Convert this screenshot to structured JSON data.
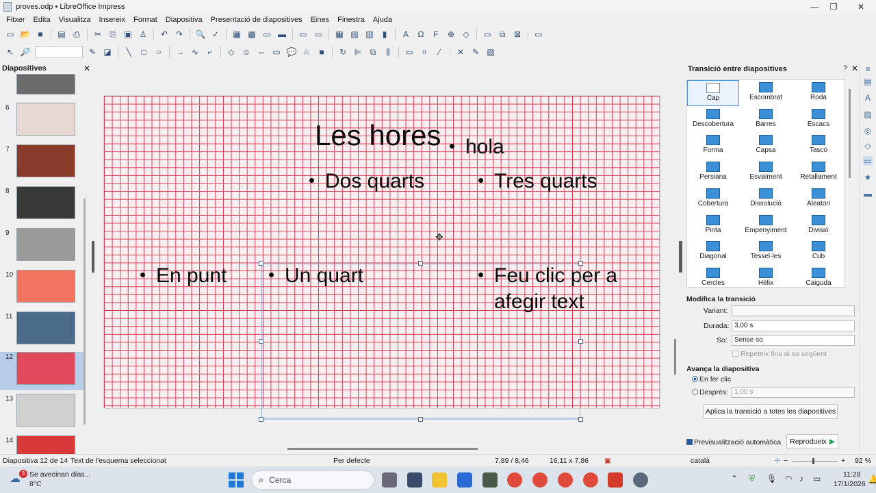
{
  "window": {
    "title": "proves.odp • LibreOffice Impress"
  },
  "menu": [
    "Fitxer",
    "Edita",
    "Visualitza",
    "Insereix",
    "Format",
    "Diapositiva",
    "Presentació de diapositives",
    "Eines",
    "Finestra",
    "Ajuda"
  ],
  "slides_pane": {
    "title": "Diapositives",
    "slides": [
      {
        "num": "",
        "color": "#6b6b6b"
      },
      {
        "num": "6",
        "color": "#e8d8d4"
      },
      {
        "num": "7",
        "color": "#8a3a2a"
      },
      {
        "num": "8",
        "color": "#3a3a3a"
      },
      {
        "num": "9",
        "color": "#9a9a9a"
      },
      {
        "num": "10",
        "color": "#f2735e"
      },
      {
        "num": "11",
        "color": "#4a6a8a"
      },
      {
        "num": "12",
        "color": "#e04a5a"
      },
      {
        "num": "13",
        "color": "#d0d0d0"
      },
      {
        "num": "14",
        "color": "#d83a3a"
      }
    ],
    "selected": "12"
  },
  "slide": {
    "title": "Les hores",
    "texts": {
      "hola": "hola",
      "dos_quarts": "Dos quarts",
      "tres_quarts": "Tres quarts",
      "en_punt": "En punt",
      "un_quart": "Un quart",
      "feu_clic_1": "Feu clic per a",
      "feu_clic_2": "afegir text"
    }
  },
  "transitions": {
    "title": "Transició entre diapositives",
    "items": [
      "Cap",
      "Escombrat",
      "Roda",
      "Descobertura",
      "Barres",
      "Escacs",
      "Forma",
      "Capsa",
      "Tascó",
      "Persiana",
      "Esvaïment",
      "Retallament",
      "Cobertura",
      "Dissolució",
      "Aleatori",
      "Pinta",
      "Empenyiment",
      "Divisió",
      "Diagonal",
      "Tessel·les",
      "Cub",
      "Cercles",
      "Hèlix",
      "Caiguda"
    ],
    "selected": "Cap",
    "modify_header": "Modifica la transició",
    "variant_label": "Variant:",
    "variant_value": "",
    "duration_label": "Durada:",
    "duration_value": "3,00 s",
    "sound_label": "So:",
    "sound_value": "Sense so",
    "repeat_label": "Repeteix fins al so següent",
    "advance_header": "Avança la diapositiva",
    "on_click_label": "En fer clic",
    "after_label": "Després:",
    "after_value": "1,00 s",
    "apply_all": "Aplica la transició a totes les diapositives",
    "autopreview_label": "Previsualització automàtica",
    "play_label": "Reprodueix"
  },
  "statusbar": {
    "slide": "Diapositiva 12 de 14",
    "selection": "Text de l'esquema seleccionat",
    "layout": "Per defecte",
    "position": "7,89 / 8,46",
    "size": "16,11 x 7,86",
    "language": "català",
    "zoom": "92 %"
  },
  "taskbar": {
    "weather_title": "Se avecinan días...",
    "weather_temp": "8°C",
    "search_placeholder": "Cerca",
    "time": "11:28",
    "date": "17/1/2026",
    "badge": "3"
  },
  "colors": {
    "grid_line": "#d43a55",
    "accent": "#3a8fd6",
    "selection": "#b8cde8"
  }
}
